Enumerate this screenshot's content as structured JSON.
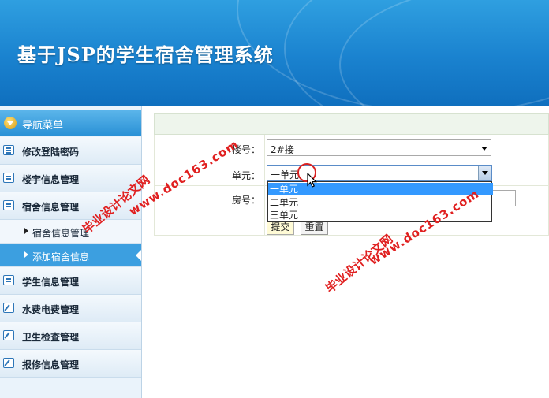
{
  "header": {
    "title": "基于JSP的学生宿舍管理系统"
  },
  "nav": {
    "title": "导航菜单",
    "items": [
      {
        "label": "修改登陆密码",
        "icon": "list-icon"
      },
      {
        "label": "楼宇信息管理",
        "icon": "chat-icon"
      },
      {
        "label": "宿舍信息管理",
        "icon": "chat-icon"
      }
    ],
    "sub_items": [
      {
        "label": "宿舍信息管理",
        "active": false
      },
      {
        "label": "添加宿舍信息",
        "active": true
      }
    ],
    "items_after": [
      {
        "label": "学生信息管理",
        "icon": "chat-icon"
      },
      {
        "label": "水费电费管理",
        "icon": "edit-icon"
      },
      {
        "label": "卫生检查管理",
        "icon": "edit-icon"
      },
      {
        "label": "报修信息管理",
        "icon": "edit-icon"
      }
    ]
  },
  "form": {
    "building_label": "楼号：",
    "building_value": "2#接",
    "unit_label": "单元：",
    "unit_value": "一单元",
    "room_label": "房号：",
    "submit_label": "提交",
    "reset_label": "重置",
    "unit_options": [
      "一单元",
      "二单元",
      "三单元"
    ],
    "unit_selected_index": 0
  },
  "watermarks": {
    "cn": "毕业设计论文网",
    "url": "www.doc163.com"
  },
  "colors": {
    "header_blue": "#1a82cf",
    "active_blue": "#3c9fe0",
    "watermark_red": "#e02020",
    "option_highlight": "#3399ff"
  }
}
